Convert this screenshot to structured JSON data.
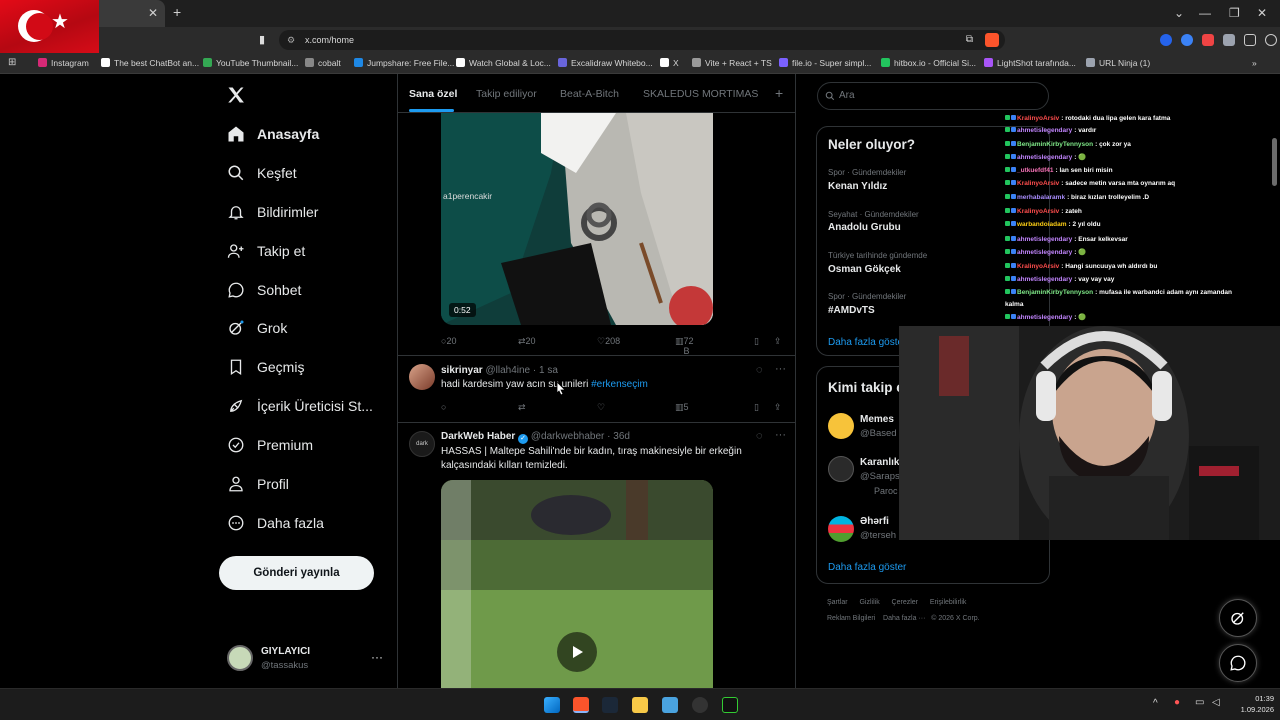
{
  "browser": {
    "url": "x.com/home",
    "bookmarks": [
      {
        "label": "Instagram",
        "color": "#d62976"
      },
      {
        "label": "The best ChatBot an...",
        "color": "#ffffff"
      },
      {
        "label": "YouTube Thumbnail...",
        "color": "#34a853"
      },
      {
        "label": "cobalt",
        "color": "#888888"
      },
      {
        "label": "Jumpshare: Free File...",
        "color": "#1e88e5"
      },
      {
        "label": "Watch Global & Loc...",
        "color": "#ffffff"
      },
      {
        "label": "Excalidraw Whitebo...",
        "color": "#6965db"
      },
      {
        "label": "X",
        "color": "#ffffff"
      },
      {
        "label": "Vite + React + TS",
        "color": "#9a9a9a"
      },
      {
        "label": "file.io - Super simpl...",
        "color": "#7b61ff"
      },
      {
        "label": "hitbox.io - Official Si...",
        "color": "#22c55e"
      },
      {
        "label": "LightShot tarafında...",
        "color": "#a855f7"
      },
      {
        "label": "URL Ninja (1)",
        "color": "#9ca3af"
      }
    ]
  },
  "nav": {
    "items": [
      {
        "label": "Anasayfa",
        "icon": "home-icon"
      },
      {
        "label": "Keşfet",
        "icon": "search-icon"
      },
      {
        "label": "Bildirimler",
        "icon": "bell-icon"
      },
      {
        "label": "Takip et",
        "icon": "follow-icon"
      },
      {
        "label": "Sohbet",
        "icon": "chat-icon"
      },
      {
        "label": "Grok",
        "icon": "grok-icon"
      },
      {
        "label": "Geçmiş",
        "icon": "bookmark-icon"
      },
      {
        "label": "İçerik Üreticisi St...",
        "icon": "rocket-icon"
      },
      {
        "label": "Premium",
        "icon": "premium-icon"
      },
      {
        "label": "Profil",
        "icon": "profile-icon"
      },
      {
        "label": "Daha fazla",
        "icon": "more-icon"
      }
    ],
    "post_button": "Gönderi yayınla",
    "account_name": "GIYLAYICI",
    "account_handle": "@tassakus"
  },
  "feed": {
    "tabs": [
      "Sana özel",
      "Takip ediliyor",
      "Beat-A-Bitch",
      "SKALEDUS MORTIMAS"
    ],
    "post1": {
      "video_watermark": "a1perencakir",
      "duration": "0:52",
      "replies": "20",
      "reposts": "20",
      "likes": "208",
      "views": "72 B"
    },
    "post2": {
      "name": "sikrinyar",
      "handle": "@llah4ine",
      "time": "· 1 sa",
      "text": "hadi kardesim yaw acın su unileri",
      "hashtag": "#erkenseçim",
      "views": "5"
    },
    "post3": {
      "name": "DarkWeb Haber",
      "handle": "@darkwebhaber",
      "time": "· 36d",
      "avatar_text": "dark",
      "text_line1": "HASSAS | Maltepe Sahili'nde bir kadın, tıraş makinesiyle bir erkeğin",
      "text_line2": "kalçasındaki kılları temizledi."
    }
  },
  "right": {
    "search_placeholder": "Ara",
    "trends_title": "Neler oluyor?",
    "trends": [
      {
        "category": "Spor · Gündemdekiler",
        "name": "Kenan Yıldız"
      },
      {
        "category": "Seyahat · Gündemdekiler",
        "name": "Anadolu Grubu"
      },
      {
        "category": "Türkiye tarihinde gündemde",
        "name": "Osman Gökçek"
      },
      {
        "category": "Spor · Gündemdekiler",
        "name": "#AMDvTS"
      }
    ],
    "trends_more": "Daha fazla göster",
    "who_title": "Kimi takip e",
    "who": [
      {
        "name": "Memes",
        "handle": "@Based"
      },
      {
        "name": "Karanlık",
        "handle": "@Saraps",
        "sub": "Paroc"
      },
      {
        "name": "Əhərfi",
        "handle": "@terseh"
      }
    ],
    "who_more": "Daha fazla göster",
    "footer_row1": [
      "Şartlar",
      "Gizlilik",
      "Çerezler",
      "Erişilebilirlik"
    ],
    "footer_row2": [
      "Reklam Bilgileri",
      "Daha fazla ···",
      "© 2026 X Corp."
    ]
  },
  "chat": [
    {
      "user": "KralinyoArsiv",
      "msg": ": rotodaki dua lipa gelen kara fatma",
      "color": "#ff4d4d"
    },
    {
      "user": "ahmetislegendary",
      "msg": ": vardır",
      "color": "#c084fc"
    },
    {
      "user": "BenjaminKirbyTennyson",
      "msg": ": çok zor ya",
      "color": "#7ee787"
    },
    {
      "user": "ahmetislegendary",
      "msg": ": 🟢",
      "color": "#c084fc"
    },
    {
      "user": "_utkuefdf41",
      "msg": ": lan sen biri misin",
      "color": "#f472b6"
    },
    {
      "user": "KralinyoArsiv",
      "msg": ": sadece metin varsa mta oynarım aq",
      "color": "#ff4d4d"
    },
    {
      "user": "merhabalaramk",
      "msg": ": biraz kızları trolleyelim .D",
      "color": "#a78bfa"
    },
    {
      "user": "KralinyoArsiv",
      "msg": ": zateh",
      "color": "#ff4d4d"
    },
    {
      "user": "warbandoiadam",
      "msg": ": 2 yıl oldu",
      "color": "#facc15"
    },
    {
      "user": "ahmetislegendary",
      "msg": ": Ensar kelkevsar",
      "color": "#c084fc"
    },
    {
      "user": "ahmetislegendary",
      "msg": ": 🟢",
      "color": "#c084fc"
    },
    {
      "user": "KralinyoArsiv",
      "msg": ": Hangi suncuuya wh aldırdı bu",
      "color": "#ff4d4d"
    },
    {
      "user": "ahmetislegendary",
      "msg": ": vay vay vay",
      "color": "#c084fc"
    },
    {
      "user": "BenjaminKirbyTennyson",
      "msg": ": mufasa ile warbandci adam aynı zamandan",
      "color": "#7ee787"
    },
    {
      "user": "",
      "msg": "kalma",
      "color": "#ffffff"
    },
    {
      "user": "ahmetislegendary",
      "msg": ": 🟢",
      "color": "#c084fc"
    }
  ],
  "taskbar": {
    "time": "01:39",
    "date": "1.09.2026"
  },
  "colors": {
    "accent": "#1d9bf0",
    "bg": "#000000",
    "border": "#2f3336",
    "muted": "#71767b"
  }
}
